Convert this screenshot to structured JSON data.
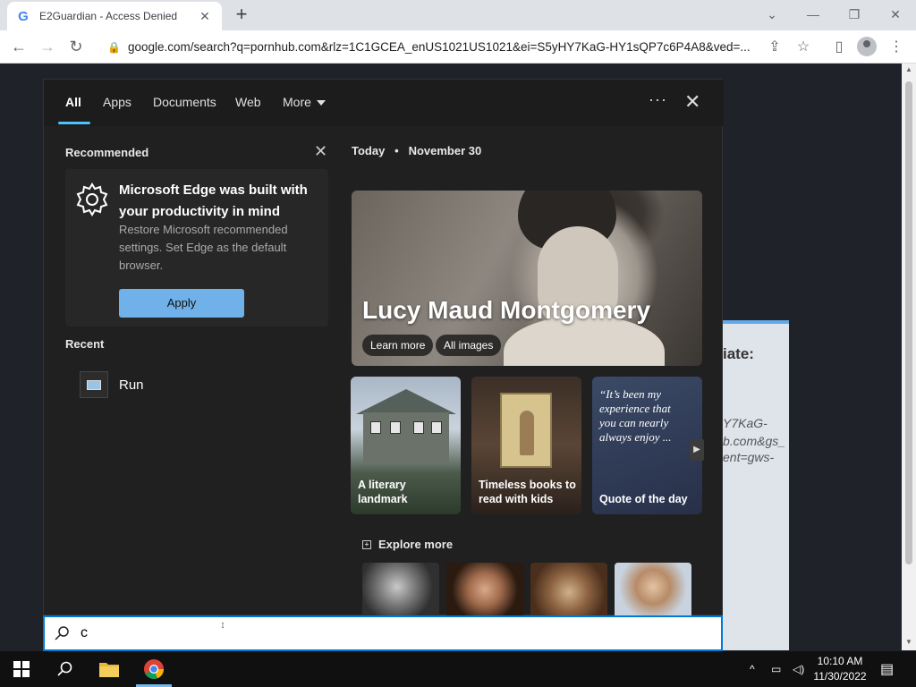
{
  "browser": {
    "tab_title": "E2Guardian - Access Denied",
    "favicon_letter": "G",
    "url": "google.com/search?q=pornhub.com&rlz=1C1GCEA_enUS1021US1021&ei=S5yHY7KaG-HY1sQP7c6P4A8&ved=..."
  },
  "page_behind": {
    "heading_fragment": "iate:",
    "url_fragments": [
      "Y7KaG-",
      "b.com&gs_",
      "ent=gws-"
    ]
  },
  "search_panel": {
    "tabs": [
      "All",
      "Apps",
      "Documents",
      "Web",
      "More"
    ],
    "active_tab": "All",
    "recommended": {
      "label": "Recommended",
      "card_title": "Microsoft Edge was built with your productivity in mind",
      "card_desc": "Restore Microsoft recommended settings. Set Edge as the default browser.",
      "apply_label": "Apply"
    },
    "recent": {
      "label": "Recent",
      "items": [
        "Run"
      ]
    },
    "today": {
      "label": "Today",
      "date": "November 30",
      "hero_name": "Lucy Maud Montgomery",
      "learn_more": "Learn more",
      "all_images": "All images",
      "tiles": [
        "A literary landmark",
        "Timeless books to read with kids",
        "Quote of the day"
      ],
      "quote_text": "“It’s been my experience that you can nearly always enjoy ...",
      "explore_more": "Explore more"
    },
    "query": "c"
  },
  "taskbar": {
    "time": "10:10 AM",
    "date": "11/30/2022"
  },
  "colors": {
    "accent_blue": "#4cc2ff",
    "apply_button": "#6fb1e8",
    "panel_bg": "#202020",
    "taskbar_bg": "#101010"
  }
}
